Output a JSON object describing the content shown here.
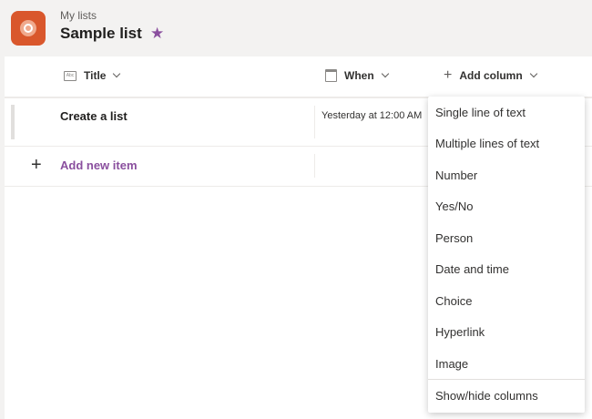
{
  "header": {
    "breadcrumb": "My lists",
    "title": "Sample list",
    "favorite_icon": "star-icon",
    "accent_color": "#8a4f9e",
    "app_color": "#d9572c"
  },
  "columns": {
    "title": "Title",
    "when": "When",
    "add_column": "Add column"
  },
  "rows": [
    {
      "title": "Create a list",
      "when": "Yesterday at 12:00 AM"
    }
  ],
  "add_item": {
    "label": "Add new item"
  },
  "add_column_menu": {
    "items": [
      "Single line of text",
      "Multiple lines of text",
      "Number",
      "Yes/No",
      "Person",
      "Date and time",
      "Choice",
      "Hyperlink",
      "Image"
    ],
    "footer": "Show/hide columns"
  }
}
